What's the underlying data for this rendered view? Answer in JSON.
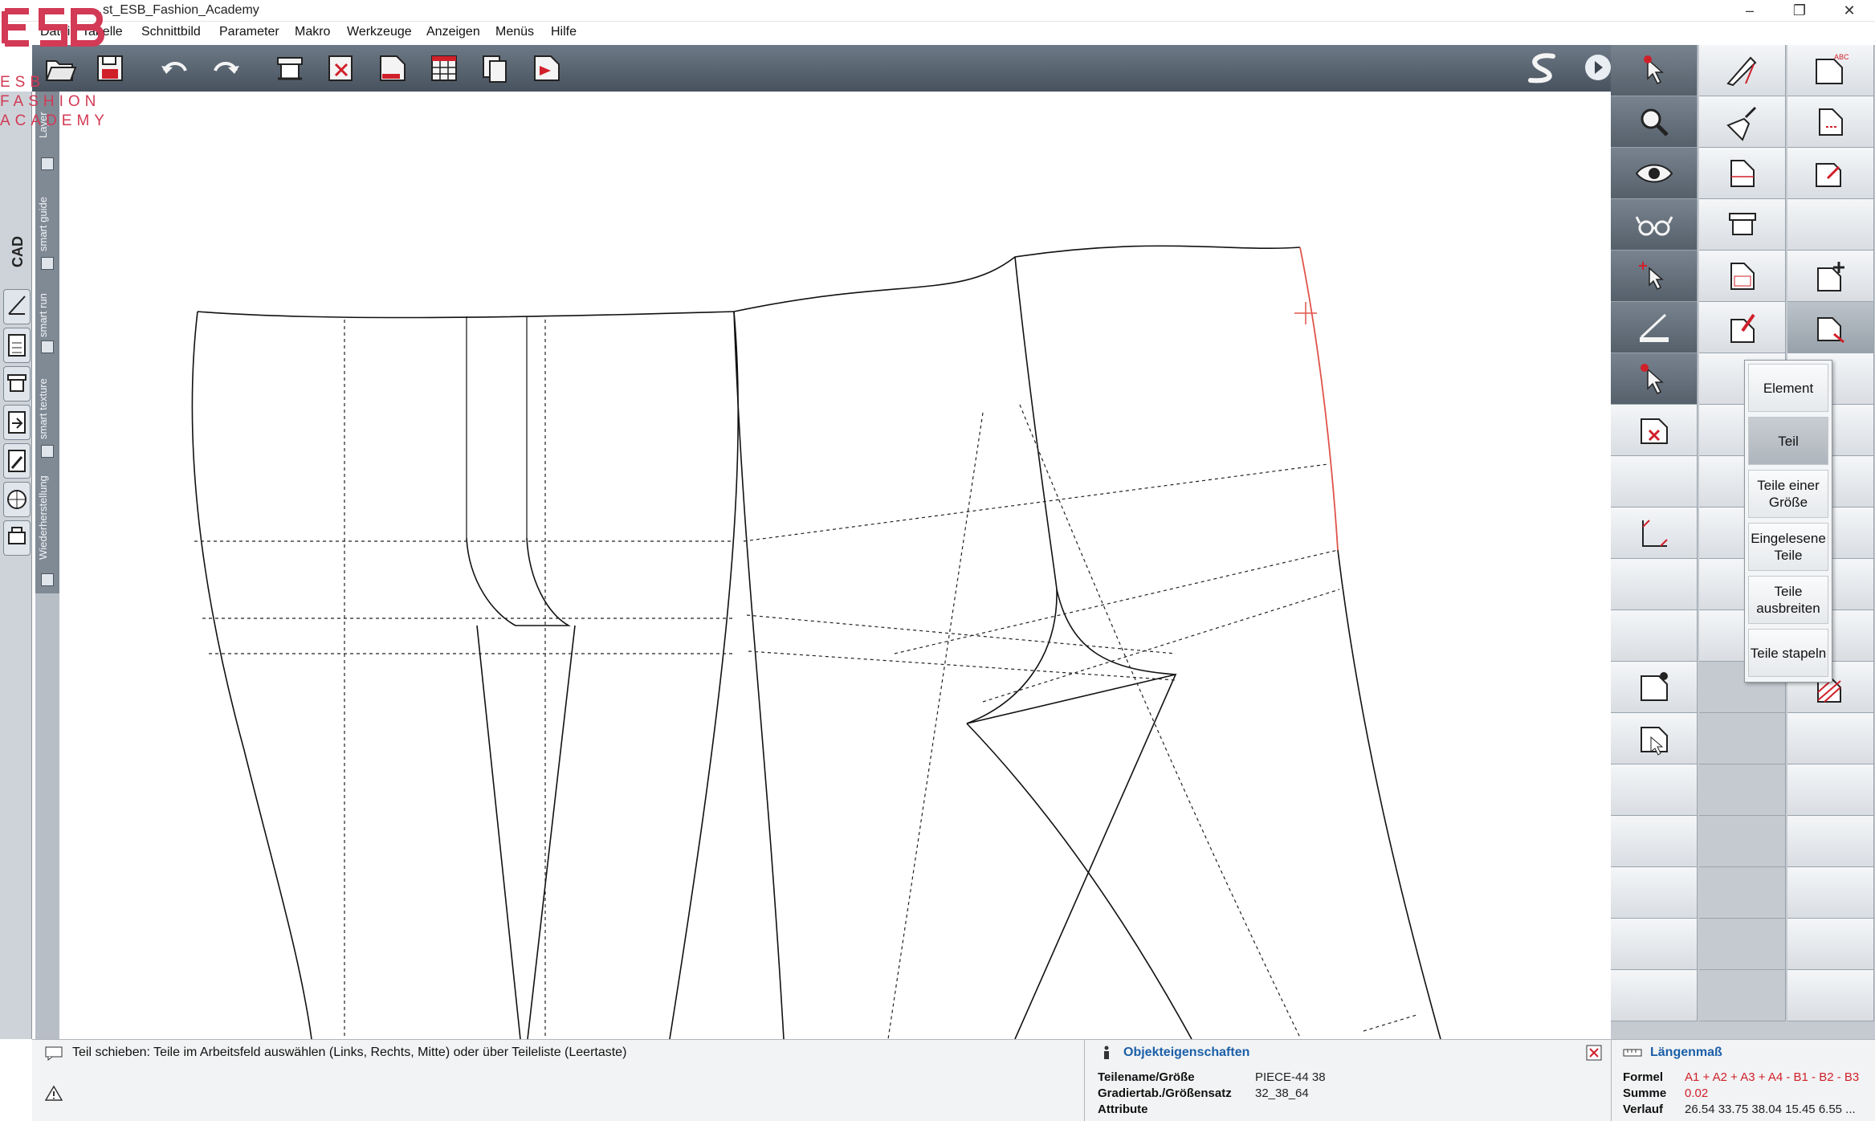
{
  "window": {
    "title": "…st_ESB_Fashion_Academy",
    "minimize": "–",
    "maximize": "❐",
    "close": "✕"
  },
  "menu": [
    "Datei",
    "Tabelle",
    "Schnittbild",
    "Parameter",
    "Makro",
    "Werkzeuge",
    "Anzeigen",
    "Menüs",
    "Hilfe"
  ],
  "left_panel": {
    "cad_label": "CAD"
  },
  "side_tabs": [
    "Layer",
    "smart guide",
    "smart run",
    "smart texture",
    "Wiederherstellung"
  ],
  "watermark": {
    "line0": "ESB",
    "line1": "FASHION",
    "line2": "ACADEMY"
  },
  "popup_menu": {
    "items": [
      "Element",
      "Teil",
      "Teile einer Größe",
      "Eingelesene Teile",
      "Teile ausbreiten",
      "Teile stapeln"
    ],
    "selected": "Teil"
  },
  "status": {
    "message": "Teil schieben: Teile im Arbeitsfeld auswählen (Links, Rechts, Mitte) oder über Teileliste (Leertaste)"
  },
  "properties": {
    "title": "Objekteigenschaften",
    "rows": [
      {
        "key": "Teilename/Größe",
        "value": "PIECE-44 38"
      },
      {
        "key": "Gradiertab./Größensatz",
        "value": "32_38_64"
      },
      {
        "key": "Attribute",
        "value": ""
      }
    ]
  },
  "lengths": {
    "title": "Längenmaß",
    "rows": [
      {
        "key": "Formel",
        "value": "A1 + A2 + A3 + A4 - B1 - B2 - B3"
      },
      {
        "key": "Summe",
        "value": "0.02"
      },
      {
        "key": "Verlauf",
        "value": "26.54 33.75 38.04 15.45 6.55 ..."
      }
    ]
  },
  "colors": {
    "accent_red": "#d0202a",
    "highlight_line": "#e0534a",
    "toolbar_dark": "#4e5965",
    "link_blue": "#1b5fa8"
  }
}
